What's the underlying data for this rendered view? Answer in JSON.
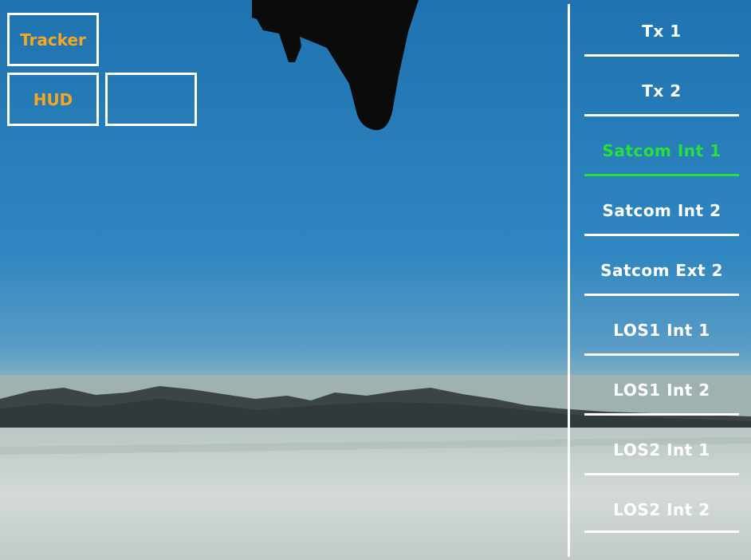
{
  "colors": {
    "accent_orange": "#f5a623",
    "active_green": "#27e03c",
    "frame_white": "#ffffff",
    "sky_top": "#1f78b4",
    "sky_horizon": "#8fb7c2",
    "ground": "#c9d3d0"
  },
  "overlay": {
    "tracker_label": "Tracker",
    "hud_label": "HUD",
    "empty_button_label": ""
  },
  "menu": {
    "active_index": 2,
    "items": [
      {
        "label": "Tx 1"
      },
      {
        "label": "Tx 2"
      },
      {
        "label": "Satcom Int 1"
      },
      {
        "label": "Satcom Int 2"
      },
      {
        "label": "Satcom Ext 2"
      },
      {
        "label": "LOS1 Int 1"
      },
      {
        "label": "LOS1 Int 2"
      },
      {
        "label": "LOS2 Int 1"
      },
      {
        "label": "LOS2 Int 2"
      }
    ]
  }
}
